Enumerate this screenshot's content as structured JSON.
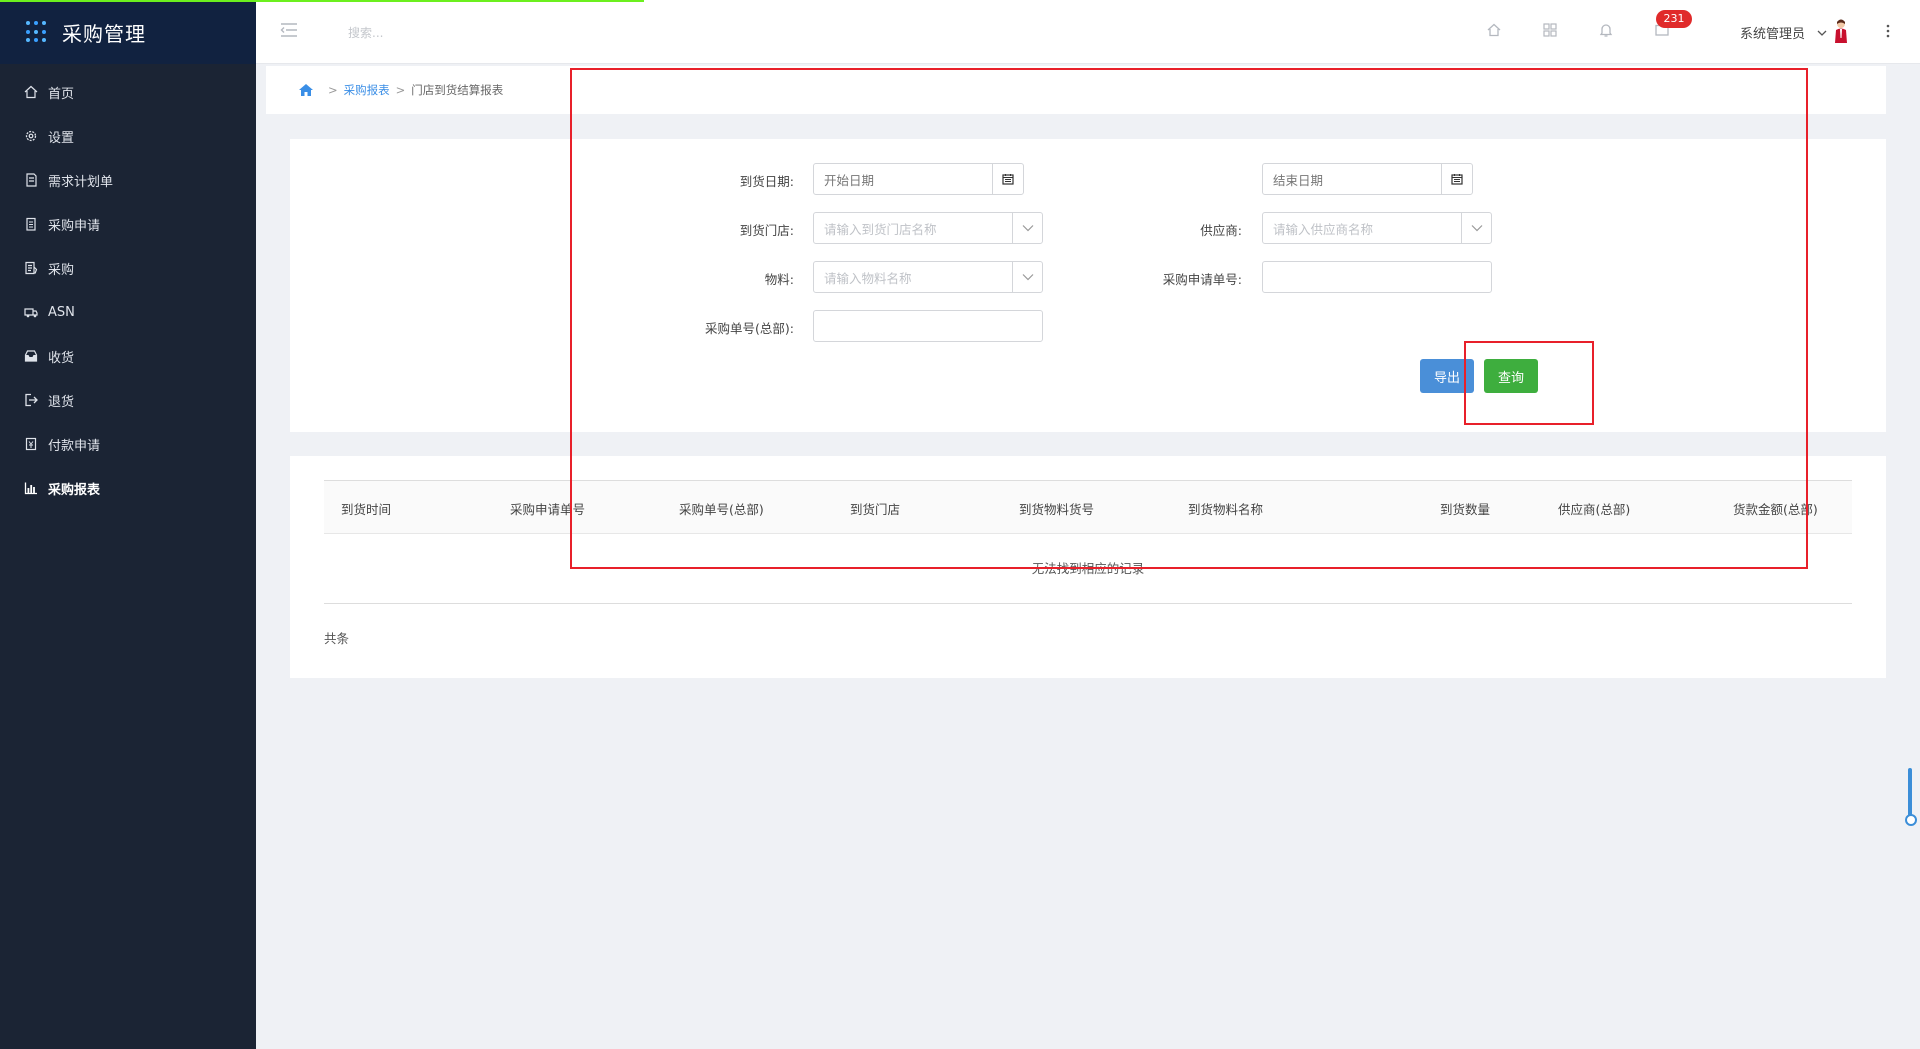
{
  "app": {
    "title": "采购管理"
  },
  "sidebar": {
    "items": [
      {
        "label": "首页",
        "icon": "home-icon"
      },
      {
        "label": "设置",
        "icon": "gear-icon"
      },
      {
        "label": "需求计划单",
        "icon": "document-icon"
      },
      {
        "label": "采购申请",
        "icon": "clipboard-icon"
      },
      {
        "label": "采购",
        "icon": "list-icon"
      },
      {
        "label": "ASN",
        "icon": "truck-icon"
      },
      {
        "label": "收货",
        "icon": "inbox-icon"
      },
      {
        "label": "退货",
        "icon": "return-icon"
      },
      {
        "label": "付款申请",
        "icon": "payment-icon"
      },
      {
        "label": "采购报表",
        "icon": "bar-chart-icon",
        "active": true
      }
    ]
  },
  "header": {
    "search_placeholder": "搜索...",
    "notification_count": "231",
    "username": "系统管理员"
  },
  "breadcrumb": {
    "link": "采购报表",
    "current": "门店到货结算报表",
    "separator": ">"
  },
  "filters": {
    "arrival_date_label": "到货日期:",
    "start_date_placeholder": "开始日期",
    "end_date_placeholder": "结束日期",
    "store_label": "到货门店:",
    "store_placeholder": "请输入到货门店名称",
    "supplier_label": "供应商:",
    "supplier_placeholder": "请输入供应商名称",
    "material_label": "物料:",
    "material_placeholder": "请输入物料名称",
    "request_no_label": "采购申请单号:",
    "request_no_value": "",
    "order_no_label": "采购单号(总部):",
    "order_no_value": "",
    "export_label": "导出",
    "query_label": "查询"
  },
  "table": {
    "columns": [
      "到货时间",
      "采购申请单号",
      "采购单号(总部)",
      "到货门店",
      "到货物料货号",
      "到货物料名称",
      "到货数量",
      "供应商(总部)",
      "货款金额(总部)"
    ],
    "empty_text": "无法找到相应的记录",
    "total_text": "共条"
  },
  "colors": {
    "sidebar_bg": "#1b2434",
    "brand_bg": "#112240",
    "accent_blue": "#4a8fd8",
    "accent_green": "#3eae3e",
    "badge_red": "#e02a2a",
    "annotation_red": "#e8202a"
  }
}
